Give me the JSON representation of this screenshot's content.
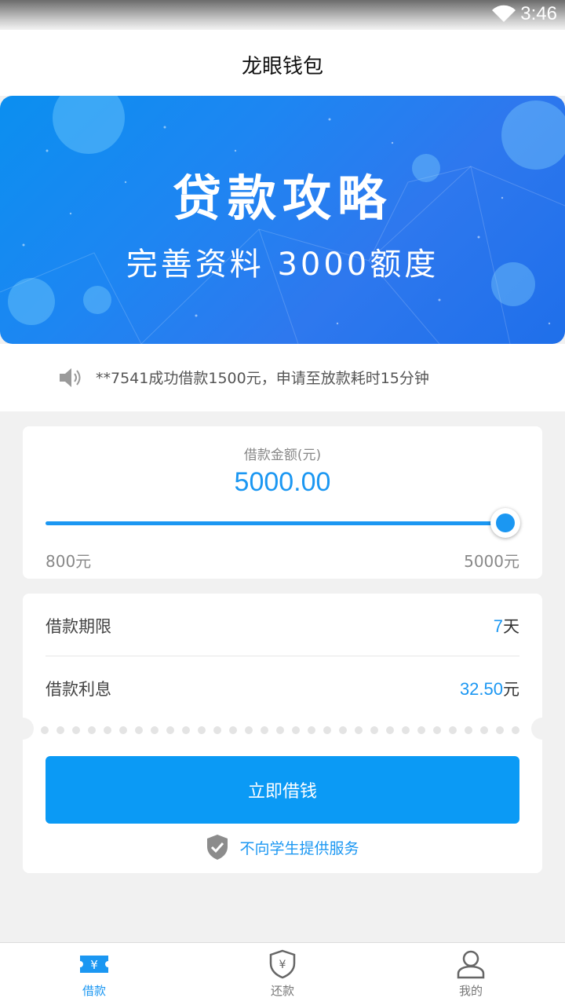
{
  "status": {
    "time": "3:46"
  },
  "header": {
    "title": "龙眼钱包"
  },
  "banner": {
    "headline": "贷款攻略",
    "subline": "完善资料 3000额度"
  },
  "notice": {
    "text": "**7541成功借款1500元，申请至放款耗时15分钟"
  },
  "amount": {
    "label": "借款金额(元)",
    "value": "5000.00",
    "min_label": "800元",
    "max_label": "5000元",
    "slider_min": 800,
    "slider_max": 5000,
    "slider_value": 5000
  },
  "details": {
    "term_label": "借款期限",
    "term_value": "7",
    "term_unit": "天",
    "interest_label": "借款利息",
    "interest_value": "32.50",
    "interest_unit": "元"
  },
  "cta": {
    "label": "立即借钱"
  },
  "safety": {
    "text": "不向学生提供服务"
  },
  "tabs": [
    {
      "label": "借款",
      "icon": "loan-ticket-icon",
      "active": true
    },
    {
      "label": "还款",
      "icon": "yen-shield-icon",
      "active": false
    },
    {
      "label": "我的",
      "icon": "person-icon",
      "active": false
    }
  ],
  "colors": {
    "accent": "#1b97f2",
    "button": "#0b9af5",
    "banner": "#1d86f2"
  }
}
